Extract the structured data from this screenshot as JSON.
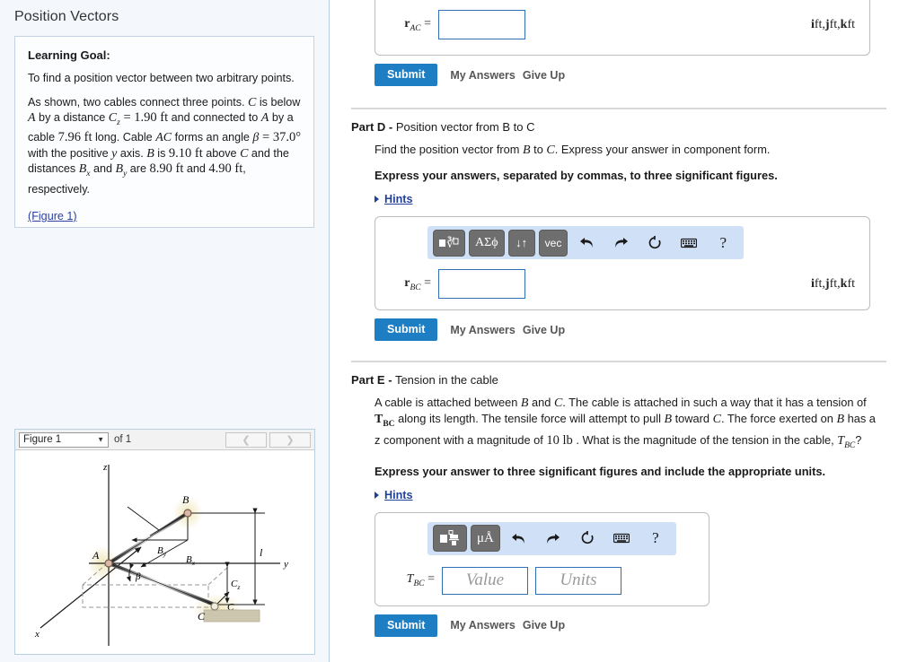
{
  "page": {
    "title": "Position Vectors"
  },
  "learning_goal": {
    "heading": "Learning Goal:",
    "paragraph1": "To find a position vector between two arbitrary points.",
    "paragraph2_parts": {
      "t1": "As shown, two cables connect three points. ",
      "C1": "C",
      "t2": " is below ",
      "A1": "A",
      "t3": " by a distance ",
      "Cz": "C",
      "Cz_sub": "z",
      "eq": " = ",
      "Cz_val": "1.90 ft",
      "t4": " and connected to ",
      "A2": "A",
      "t5": " by a cable ",
      "len": "7.96 ft",
      "t6": " long. Cable ",
      "AC": "AC",
      "t7": " forms an angle ",
      "beta": "β",
      "eq2": " = ",
      "beta_val": "37.0°",
      "t8": " with the positive ",
      "yaxis": "y",
      "t9": " axis. ",
      "B1": "B",
      "t10": " is ",
      "Bheight": "9.10 ft",
      "t11": " above ",
      "C2": "C",
      "t12": " and the distances ",
      "Bx": "B",
      "Bx_sub": "x",
      "t13": " and ",
      "By": "B",
      "By_sub": "y",
      "t14": " are ",
      "Bx_val": "8.90 ft",
      "t15": " and ",
      "By_val": "4.90 ft",
      "t16": ", respectively."
    },
    "figure_link": "(Figure 1)"
  },
  "figure_panel": {
    "select_value": "Figure 1",
    "of_label": "of 1",
    "prev_icon": "chevron-left-icon",
    "next_icon": "chevron-right-icon",
    "diagram": {
      "axis_z": "z",
      "axis_y": "y",
      "axis_x": "x",
      "point_A": "A",
      "point_B": "B",
      "point_C": "C",
      "label_By": "B",
      "label_By_sub": "y",
      "label_Bx": "B",
      "label_Bx_sub": "x",
      "label_Cz": "C",
      "label_Cz_sub": "z",
      "label_Cx": "C",
      "label_Cx_sub": "x",
      "label_beta": "β",
      "label_l": "l"
    }
  },
  "mathbar": {
    "template_btn": "template-icon",
    "greek_btn": "ΑΣϕ",
    "arrows_btn": "↓↑",
    "vec_btn": "vec",
    "undo_icon": "undo-icon",
    "redo_icon": "redo-icon",
    "reset_icon": "reset-icon",
    "keyboard_icon": "keyboard-icon",
    "help_icon": "?",
    "fraction_btn": "fraction-icon",
    "units_btn": "μÅ"
  },
  "part_c": {
    "answer_label_r": "r",
    "answer_label_sub": "AC",
    "answer_label_eq": "=",
    "answer_value": "",
    "units_text": "i ft, j ft, k ft",
    "units_i": "i",
    "units_j": "j",
    "units_k": "k",
    "units_ft": "ft",
    "submit_label": "Submit",
    "my_answers_label": "My Answers",
    "give_up_label": "Give Up"
  },
  "part_d": {
    "part_name": "Part D",
    "dash": "-",
    "part_title": "Position vector from B to C",
    "question_parts": {
      "t1": "Find the position vector from ",
      "B": "B",
      "t2": " to ",
      "C": "C",
      "t3": ". Express your answer in component form."
    },
    "instruction": "Express your answers, separated by commas, to three significant figures.",
    "hints_label": "Hints",
    "answer_label_r": "r",
    "answer_label_sub": "BC",
    "answer_label_eq": "=",
    "answer_value": "",
    "units_i": "i",
    "units_j": "j",
    "units_k": "k",
    "units_ft": "ft",
    "submit_label": "Submit",
    "my_answers_label": "My Answers",
    "give_up_label": "Give Up"
  },
  "part_e": {
    "part_name": "Part E",
    "dash": "-",
    "part_title": "Tension in the cable",
    "question_parts": {
      "t1": "A cable is attached between ",
      "B1": "B",
      "t2": " and ",
      "C1": "C",
      "t3": ". The cable is attached in such a way that it has a tension of ",
      "T1": "T",
      "T1_sub": "BC",
      "t4": " along its length. The tensile force will attempt to pull ",
      "B2": "B",
      "t5": " toward ",
      "C2": "C",
      "t6": ". The force exerted on ",
      "B3": "B",
      "t7": " has a ",
      "z": "z",
      "t8": " component with a magnitude of ",
      "mag": "10 lb",
      "t9": " . What is the magnitude of the tension in the cable, ",
      "T2": "T",
      "T2_sub": "BC",
      "t10": "?"
    },
    "instruction": "Express your answer to three significant figures and include the appropriate units.",
    "hints_label": "Hints",
    "answer_label_T": "T",
    "answer_label_sub": "BC",
    "answer_label_eq": "=",
    "value_placeholder": "Value",
    "units_placeholder": "Units",
    "submit_label": "Submit",
    "my_answers_label": "My Answers",
    "give_up_label": "Give Up"
  },
  "colors": {
    "accent_blue": "#1d7ec4",
    "mathbar_bg": "#cfe0f7",
    "link_blue": "#21409a",
    "sidebar_bg": "#f4f8fd",
    "input_border": "#2f6fb5"
  }
}
